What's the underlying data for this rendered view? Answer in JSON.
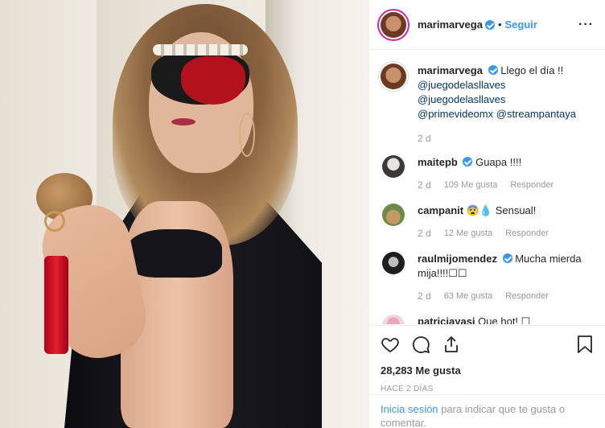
{
  "post": {
    "author": "marimarvega",
    "follow_label": "Seguir",
    "separator": "•",
    "more_label": "···"
  },
  "caption": {
    "user": "marimarvega",
    "text": "Llego el día !!",
    "mentions": [
      "@juegodelasllaves",
      "@juegodelasllaves",
      "@primevideomx",
      "@streampantaya"
    ],
    "time": "2 d"
  },
  "comments": [
    {
      "user": "maitepb",
      "text": "Guapa !!!!",
      "time": "2 d",
      "likes": "109 Me gusta",
      "reply": "Responder",
      "verified": true
    },
    {
      "user": "campanit",
      "text": "😨💧 Sensual!",
      "time": "2 d",
      "likes": "12 Me gusta",
      "reply": "Responder",
      "verified": false
    },
    {
      "user": "raulmijomendez",
      "text": "Mucha mierda mija!!!!☐☐",
      "time": "2 d",
      "likes": "63 Me gusta",
      "reply": "Responder",
      "verified": true
    },
    {
      "user": "patriciayasi",
      "text": "Que hot! ☐",
      "time": "",
      "likes": "",
      "reply": "",
      "verified": false
    }
  ],
  "likes_count": "28,283 Me gusta",
  "date_label": "HACE 2 DÍAS",
  "login": {
    "link": "Inicia sesión",
    "rest": " para indicar que te gusta o comentar."
  },
  "icons": {
    "like": "heart-icon",
    "comment": "comment-icon",
    "share": "share-icon",
    "save": "bookmark-icon",
    "verified": "verified-badge-icon"
  },
  "colors": {
    "link": "#3897f0",
    "mention": "#003569",
    "muted": "#999999"
  }
}
